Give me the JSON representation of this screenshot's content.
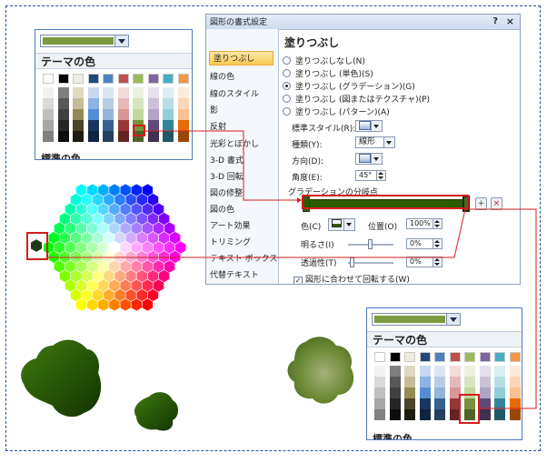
{
  "palette_left": {
    "title": "テーマの色",
    "footer": "標準の色",
    "selected_color": "#7a9a3c"
  },
  "palette_right": {
    "title": "テーマの色",
    "footer": "標準の色",
    "selected_color": "#7a9a3c"
  },
  "theme_colors": {
    "columns": [
      [
        "#ffffff",
        "#f2f2f2",
        "#d9d9d9",
        "#bfbfbf",
        "#a6a6a6",
        "#808080"
      ],
      [
        "#000000",
        "#7f7f7f",
        "#595959",
        "#404040",
        "#262626",
        "#0d0d0d"
      ],
      [
        "#eeece1",
        "#ddd9c3",
        "#c4bd97",
        "#948a54",
        "#4a452a",
        "#1e1c11"
      ],
      [
        "#1f497d",
        "#c6d9f1",
        "#8db3e2",
        "#548dd4",
        "#17375e",
        "#0f243e"
      ],
      [
        "#4f81bd",
        "#dbe5f1",
        "#b8cce4",
        "#95b3d7",
        "#366092",
        "#244061"
      ],
      [
        "#c0504d",
        "#f2dcdb",
        "#e6b9b8",
        "#d99694",
        "#953735",
        "#632523"
      ],
      [
        "#9bbb59",
        "#ebf1dd",
        "#d7e4bd",
        "#c3d69b",
        "#76923c",
        "#4f6228"
      ],
      [
        "#8064a2",
        "#e5e0ec",
        "#ccc1d9",
        "#b2a2c7",
        "#5f497a",
        "#3f3151"
      ],
      [
        "#4bacc6",
        "#dbeef3",
        "#b7dde8",
        "#92cddc",
        "#31859b",
        "#205867"
      ],
      [
        "#f79646",
        "#fdeada",
        "#fbd5b5",
        "#fac08f",
        "#e36c09",
        "#974806"
      ]
    ]
  },
  "dialog": {
    "title": "図形の書式設定",
    "help_icon": "?",
    "close_icon": "×",
    "nav": [
      "塗りつぶし",
      "線の色",
      "線のスタイル",
      "影",
      "反射",
      "光彩とぼかし",
      "3-D 書式",
      "3-D 回転",
      "図の修整",
      "図の色",
      "アート効果",
      "トリミング",
      "テキスト ボックス",
      "代替テキスト"
    ],
    "section_title": "塗りつぶし",
    "fill_options": [
      "塗りつぶしなし(N)",
      "塗りつぶし (単色)(S)",
      "塗りつぶし (グラデーション)(G)",
      "塗りつぶし (図またはテクスチャ)(P)",
      "塗りつぶし (パターン)(A)"
    ],
    "selected_fill": 2,
    "preset_label": "標準スタイル(R):",
    "type_label": "種類(Y):",
    "type_value": "線形",
    "direction_label": "方向(D):",
    "angle_label": "角度(E):",
    "angle_value": "45°",
    "stops_label": "グラデーションの分岐点",
    "color_label": "色(C)",
    "position_label": "位置(O)",
    "position_value": "100%",
    "brightness_label": "明るさ(I)",
    "brightness_value": "0%",
    "transparency_label": "透過性(T)",
    "transparency_value": "0%",
    "rotate_check_label": "図形に合わせて回転する(W)",
    "gradient_color": "#2e5b00"
  },
  "blobs": {
    "dark_green": "#1f4a00",
    "olive": "#6f8c3a"
  }
}
